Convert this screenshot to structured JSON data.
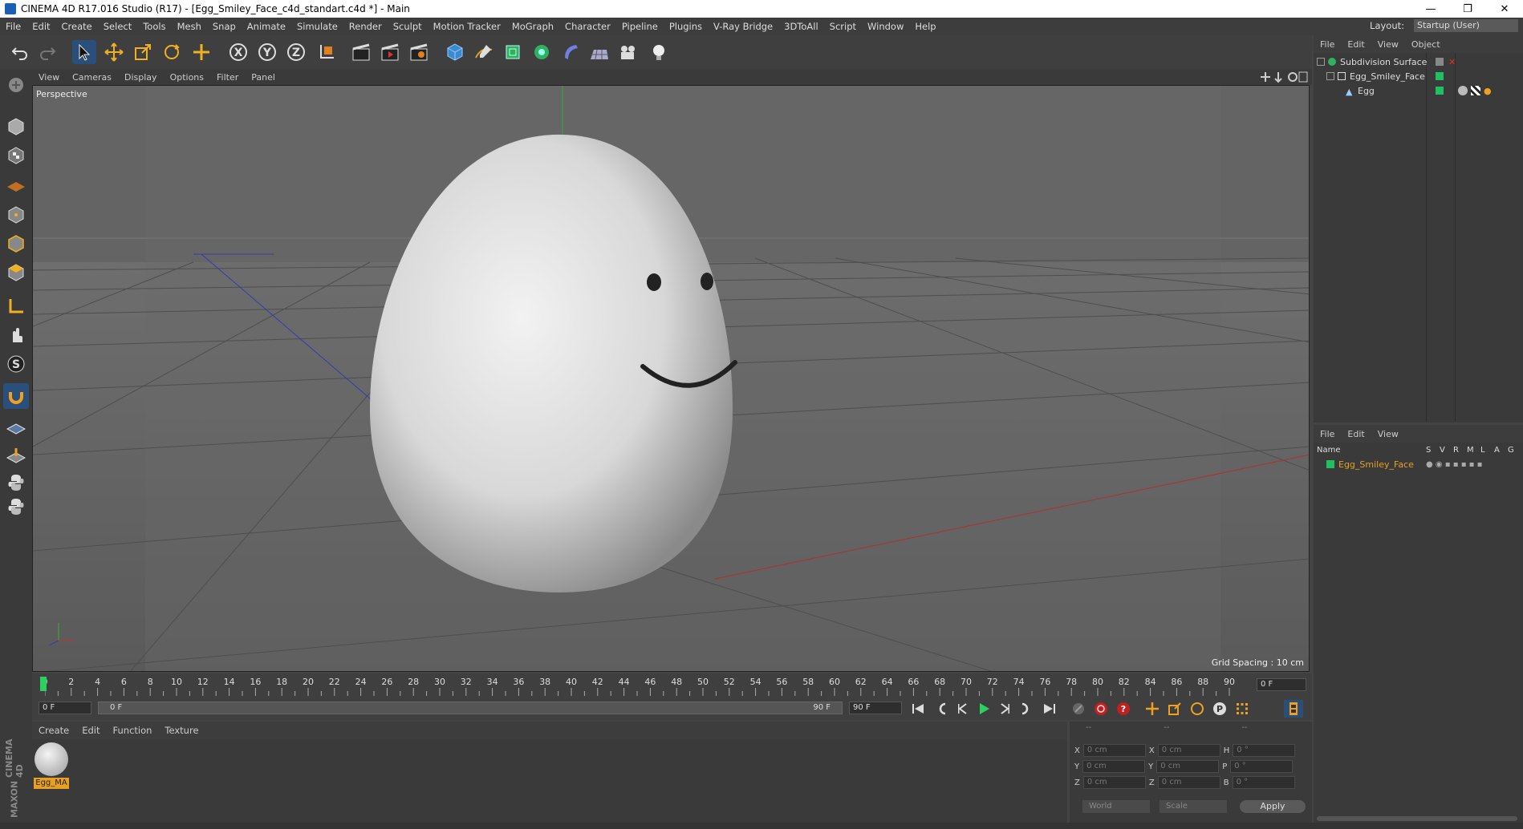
{
  "window": {
    "title": "CINEMA 4D R17.016 Studio (R17) - [Egg_Smiley_Face_c4d_standart.c4d *] - Main"
  },
  "menu": [
    "File",
    "Edit",
    "Create",
    "Select",
    "Tools",
    "Mesh",
    "Snap",
    "Animate",
    "Simulate",
    "Render",
    "Sculpt",
    "Motion Tracker",
    "MoGraph",
    "Character",
    "Pipeline",
    "Plugins",
    "V-Ray Bridge",
    "3DToAll",
    "Script",
    "Window",
    "Help"
  ],
  "layout": {
    "label": "Layout:",
    "value": "Startup (User)"
  },
  "viewport": {
    "menu": [
      "View",
      "Cameras",
      "Display",
      "Options",
      "Filter",
      "Panel"
    ],
    "label": "Perspective",
    "grid_spacing": "Grid Spacing : 10 cm"
  },
  "timeline": {
    "ticks": [
      "0",
      "2",
      "4",
      "6",
      "8",
      "10",
      "12",
      "14",
      "16",
      "18",
      "20",
      "22",
      "24",
      "26",
      "28",
      "30",
      "32",
      "34",
      "36",
      "38",
      "40",
      "42",
      "44",
      "46",
      "48",
      "50",
      "52",
      "54",
      "56",
      "58",
      "60",
      "62",
      "64",
      "66",
      "68",
      "70",
      "72",
      "74",
      "76",
      "78",
      "80",
      "82",
      "84",
      "86",
      "88",
      "90"
    ],
    "current_frame": "0 F",
    "start": "0 F",
    "slider_start": "0 F",
    "slider_end": "90 F",
    "end": "90 F"
  },
  "material": {
    "menu": [
      "Create",
      "Edit",
      "Function",
      "Texture"
    ],
    "name": "Egg_MA"
  },
  "coords": {
    "headers": [
      "--",
      "--",
      "--"
    ],
    "rows": [
      {
        "a": "X",
        "v1": "0 cm",
        "b": "X",
        "v2": "0 cm",
        "c": "H",
        "v3": "0 °"
      },
      {
        "a": "Y",
        "v1": "0 cm",
        "b": "Y",
        "v2": "0 cm",
        "c": "P",
        "v3": "0 °"
      },
      {
        "a": "Z",
        "v1": "0 cm",
        "b": "Z",
        "v2": "0 cm",
        "c": "B",
        "v3": "0 °"
      }
    ],
    "world": "World",
    "scale": "Scale",
    "apply": "Apply"
  },
  "objects": {
    "menu": [
      "File",
      "Edit",
      "View",
      "Object"
    ],
    "items": [
      "Subdivision Surface",
      "Egg_Smiley_Face",
      "Egg"
    ]
  },
  "layers": {
    "menu": [
      "File",
      "Edit",
      "View"
    ],
    "columns": [
      "Name",
      "S",
      "V",
      "R",
      "M",
      "L",
      "A",
      "G"
    ],
    "item": "Egg_Smiley_Face"
  },
  "logo": {
    "line1": "MAXON",
    "line2": "CINEMA 4D"
  },
  "colors": {
    "accent": "#e8a020",
    "green": "#20c060"
  }
}
